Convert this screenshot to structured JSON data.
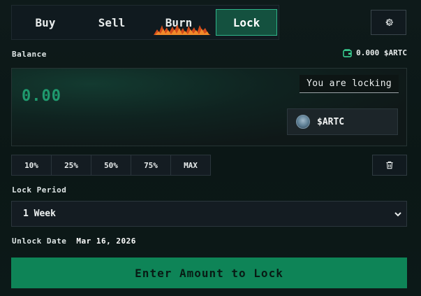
{
  "tabs": [
    {
      "label": "Buy"
    },
    {
      "label": "Sell"
    },
    {
      "label": "Burn"
    },
    {
      "label": "Lock",
      "active": true
    }
  ],
  "icons": {
    "settings": "gear-icon",
    "wallet": "wallet-icon",
    "trash": "trash-icon",
    "chevron": "chevron-down-icon",
    "token": "token-logo"
  },
  "balance": {
    "label": "Balance",
    "value": "0.000 $ARTC"
  },
  "input": {
    "amount": "0.00",
    "locking_label": "You are locking",
    "token": "$ARTC"
  },
  "percent_buttons": [
    "10%",
    "25%",
    "50%",
    "75%",
    "MAX"
  ],
  "lock_period": {
    "label": "Lock Period",
    "selected": "1 Week"
  },
  "unlock": {
    "label": "Unlock Date",
    "value": "Mar 16, 2026"
  },
  "cta": {
    "label": "Enter Amount to Lock"
  },
  "colors": {
    "accent": "#0e8457",
    "active_tab_border": "#2fb58a",
    "amount_text": "#1f9a6e",
    "wallet_icon": "#3ddc9b"
  }
}
